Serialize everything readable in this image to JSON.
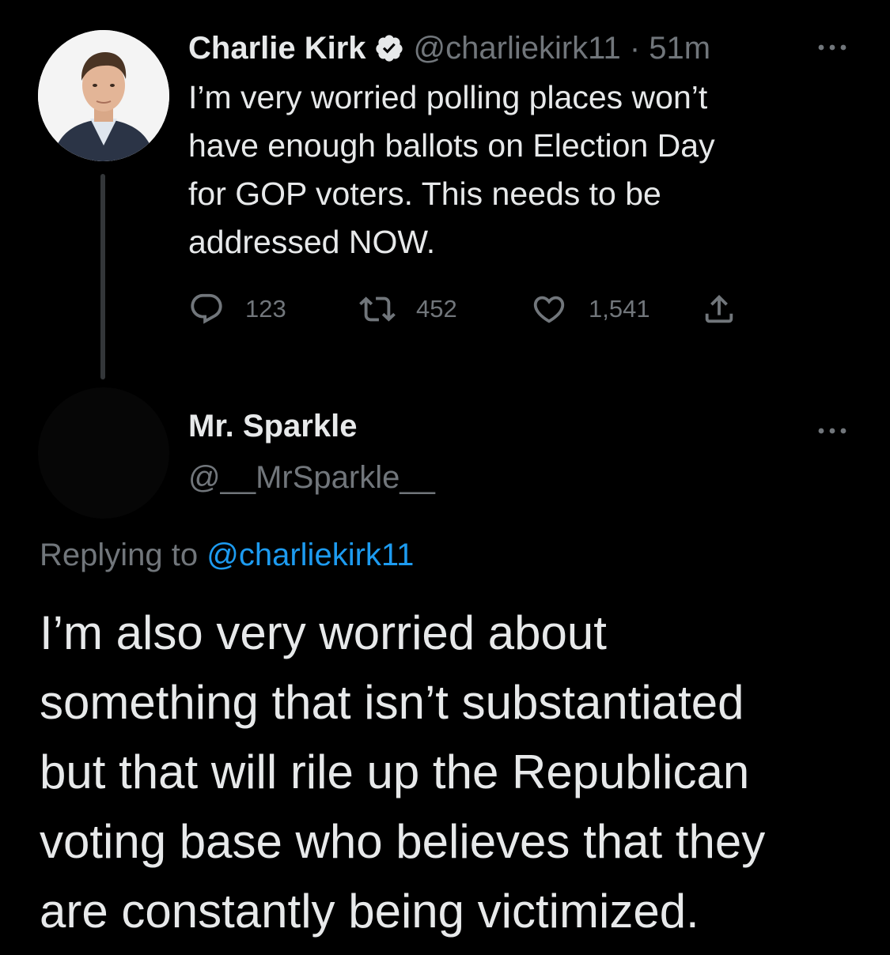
{
  "tweet": {
    "author_name": "Charlie Kirk",
    "handle": "@charliekirk11",
    "separator": "·",
    "time": "51m",
    "text_lines": [
      "I’m very worried polling places won’t",
      "have enough ballots on Election Day",
      "for GOP voters. This needs to be",
      "addressed NOW."
    ],
    "replies": "123",
    "retweets": "452",
    "likes": "1,541"
  },
  "reply": {
    "author_name": "Mr. Sparkle",
    "handle": "@__MrSparkle__",
    "replying_prefix": "Replying to",
    "replying_to": "@charliekirk11",
    "text_lines": [
      "I’m also very worried about",
      "something that isn’t substantiated",
      "but that will rile up the Republican",
      "voting base who believes that they",
      "are constantly being victimized."
    ]
  },
  "icons": {
    "verified": "verified-badge-icon",
    "more": "more-icon",
    "reply": "reply-icon",
    "retweet": "retweet-icon",
    "like": "heart-icon",
    "share": "share-icon"
  },
  "colors": {
    "background": "#000000",
    "text_primary": "#e7e9ea",
    "text_secondary": "#71767b",
    "link": "#1d9bf0",
    "thread_line": "#333639"
  }
}
